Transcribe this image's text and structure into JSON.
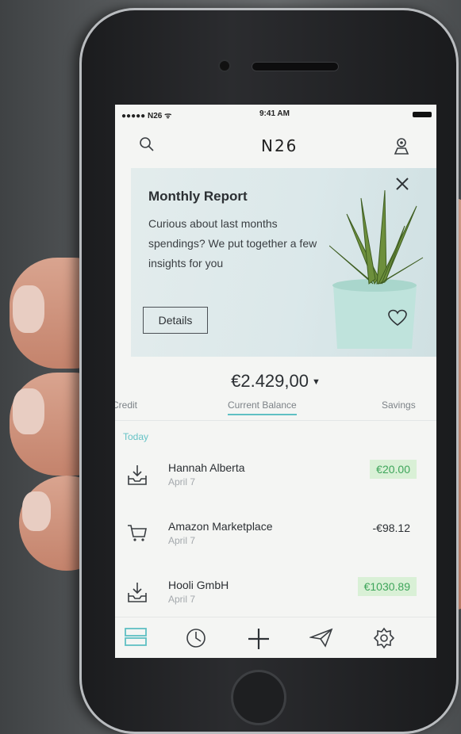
{
  "status_bar": {
    "carrier": "●●●●● N26 ᯤ",
    "time": "9:41 AM"
  },
  "header": {
    "logo": "N26"
  },
  "report": {
    "title": "Monthly Report",
    "body": "Curious about last months spendings? We put together a few insights for you",
    "button": "Details"
  },
  "balance": {
    "amount": "€2.429,00"
  },
  "account_tabs": [
    "Credit",
    "Current Balance",
    "Savings"
  ],
  "section": "Today",
  "transactions": [
    {
      "name": "Hannah Alberta",
      "date": "April 7",
      "amount": "€20.00",
      "icon": "inbox-icon"
    },
    {
      "name": "Amazon Marketplace",
      "date": "April 7",
      "amount": "-€98.12",
      "icon": "cart-icon"
    },
    {
      "name": "Hooli GmbH",
      "date": "April 7",
      "amount": "€1030.89",
      "icon": "inbox-icon"
    }
  ],
  "tabs": [
    "transactions-tab",
    "stats-tab",
    "add-tab",
    "send-tab",
    "settings-tab"
  ],
  "colors": {
    "accent": "#5fc0c4",
    "positive_bg": "#d9f0d6",
    "positive_text": "#3ea55a"
  }
}
